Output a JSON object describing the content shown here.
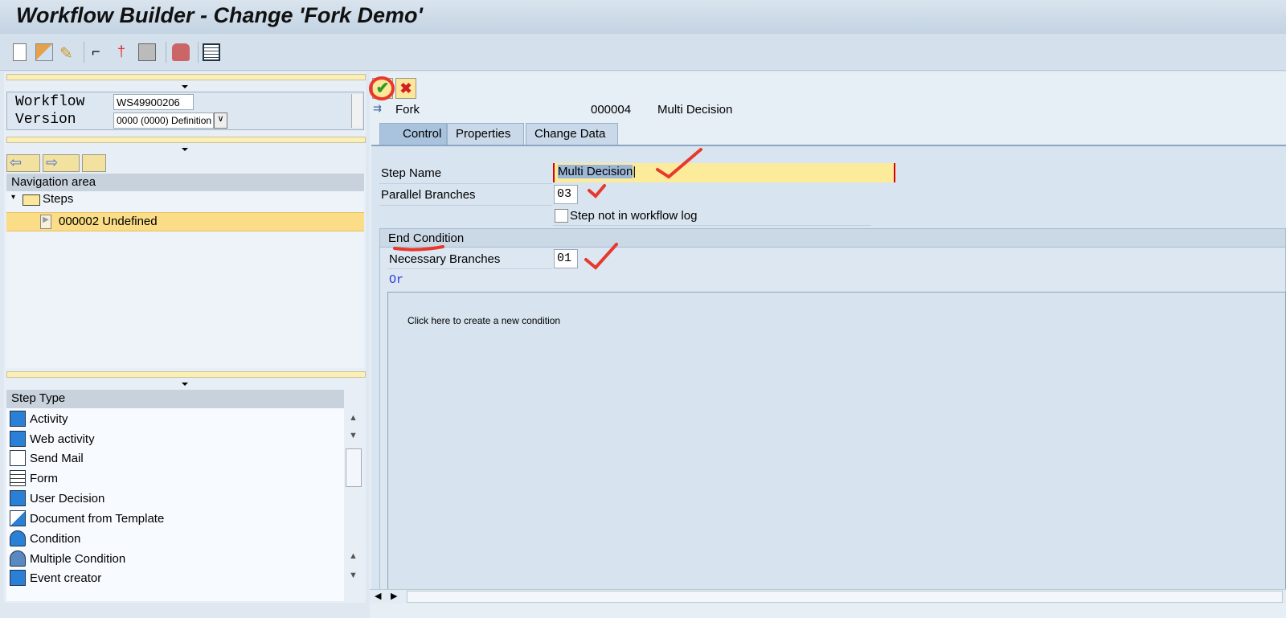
{
  "window": {
    "title": "Workflow Builder - Change 'Fork Demo'"
  },
  "left": {
    "workflow_label": "Workflow",
    "workflow_value": "WS49900206",
    "version_label": "Version",
    "version_value": "0000 (0000) Definition",
    "nav_header": "Navigation area",
    "tree_root": "Steps",
    "tree_item": "000002 Undefined",
    "steptype_header": "Step Type",
    "step_types": [
      "Activity",
      "Web activity",
      "Send Mail",
      "Form",
      "User Decision",
      "Document from Template",
      "Condition",
      "Multiple Condition",
      "Event creator"
    ]
  },
  "right": {
    "step_type": "Fork",
    "step_number": "000004",
    "step_title": "Multi Decision",
    "tabs": [
      "Control",
      "Properties",
      "Change Data"
    ],
    "step_name_label": "Step Name",
    "step_name_value": "Multi Decision",
    "parallel_label": "Parallel Branches",
    "parallel_value": "03",
    "log_checkbox_label": "Step not in workflow log",
    "log_checked": false,
    "end_condition_header": "End Condition",
    "necessary_label": "Necessary Branches",
    "necessary_value": "01",
    "or_label": "Or",
    "condition_hint": "Click here to create a new condition"
  },
  "colors": {
    "annotation": "#e8382c",
    "selection": "#fbdc87",
    "input_highlight": "#fdeb9c"
  }
}
